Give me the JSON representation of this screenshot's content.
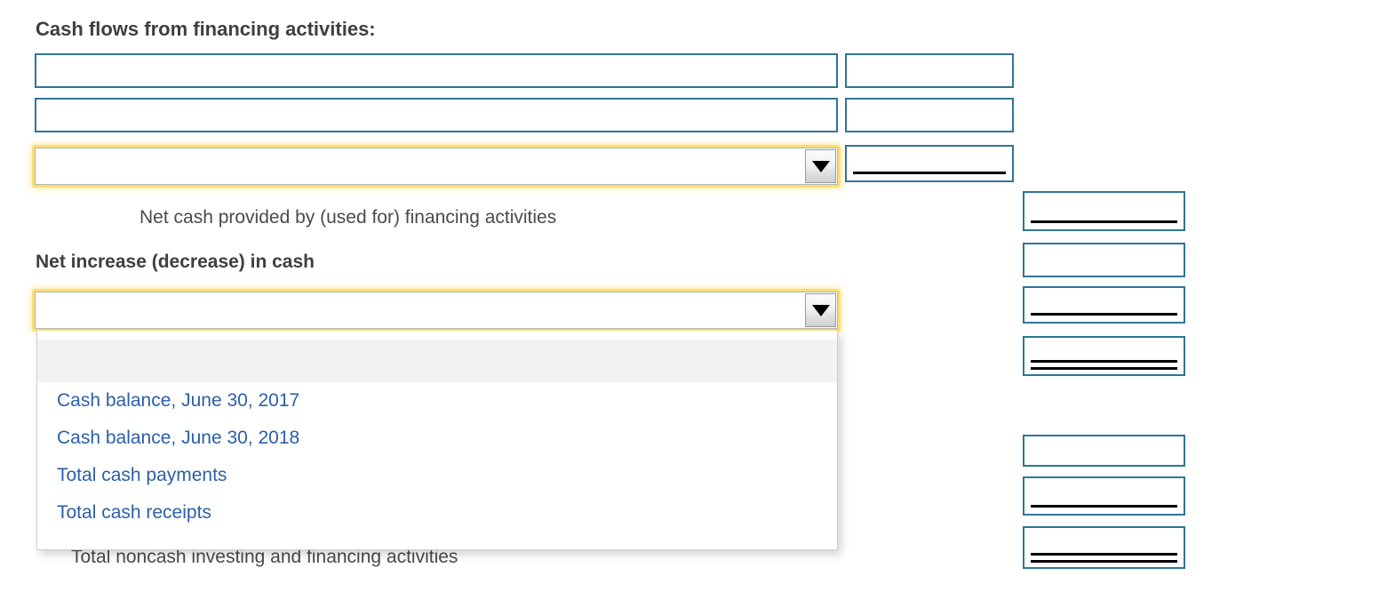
{
  "page": {
    "background_color": "#ffffff",
    "box_border_color": "#2f7696",
    "focus_highlight_color": "#fbdf72",
    "link_color": "#2c5fa8",
    "text_color": "#444444"
  },
  "labels": {
    "section_heading": "Cash flows from financing activities:",
    "net_cash_financing": "Net cash provided by (used for) financing activities",
    "net_increase_decrease": "Net increase (decrease) in cash",
    "total_noncash": "Total noncash investing and financing activities"
  },
  "selects": {
    "financing_line_select": {
      "value": "",
      "arrow_icon": "chevron-down-icon",
      "expanded": false
    },
    "cash_balance_select": {
      "value": "",
      "arrow_icon": "chevron-down-icon",
      "expanded": true,
      "options": [
        {
          "label": "",
          "blank": true,
          "highlighted": true
        },
        {
          "label": "Cash balance, June 30, 2017",
          "blank": false,
          "highlighted": false
        },
        {
          "label": "Cash balance, June 30, 2018",
          "blank": false,
          "highlighted": false
        },
        {
          "label": "Total cash payments",
          "blank": false,
          "highlighted": false
        },
        {
          "label": "Total cash receipts",
          "blank": false,
          "highlighted": false
        }
      ]
    }
  },
  "entry_cells": {
    "description_col": [
      {
        "value": "",
        "underline": "none"
      },
      {
        "value": "",
        "underline": "none"
      }
    ],
    "amount_col": [
      {
        "value": "",
        "underline": "none"
      },
      {
        "value": "",
        "underline": "none"
      },
      {
        "value": "",
        "underline": "single"
      }
    ],
    "total_col": [
      {
        "value": "",
        "underline": "single"
      },
      {
        "value": "",
        "underline": "none"
      },
      {
        "value": "",
        "underline": "single"
      },
      {
        "value": "",
        "underline": "double"
      },
      {
        "value": "",
        "underline": "none"
      },
      {
        "value": "",
        "underline": "single"
      },
      {
        "value": "",
        "underline": "double"
      }
    ]
  }
}
